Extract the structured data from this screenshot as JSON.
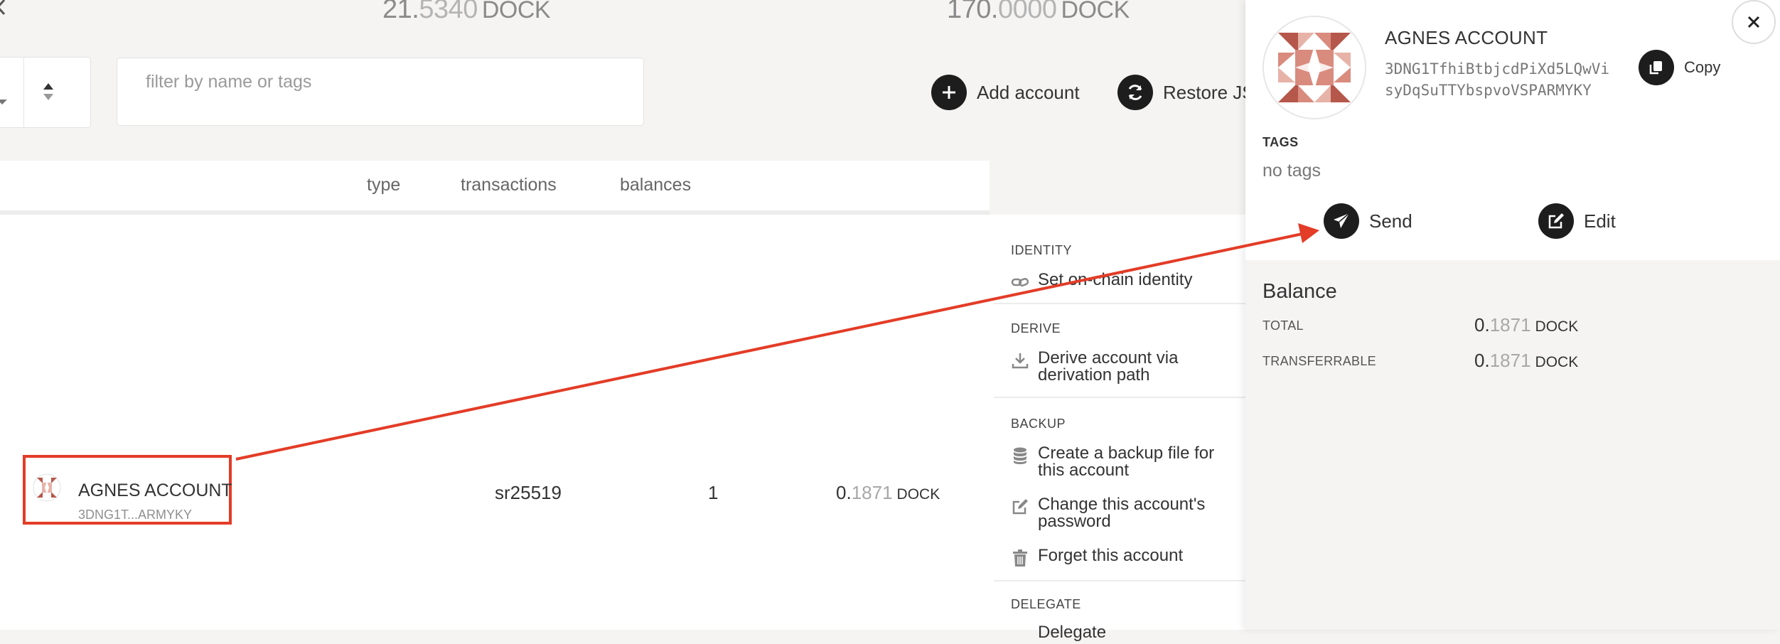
{
  "summary": {
    "left": {
      "int": "21.",
      "dec": "5340",
      "unit": "DOCK"
    },
    "right": {
      "int": "170.",
      "dec": "0000",
      "unit": "DOCK"
    }
  },
  "controls": {
    "filter_placeholder": "filter by name or tags",
    "add_account": "Add account",
    "restore_json": "Restore JSON"
  },
  "table": {
    "headers": {
      "type": "type",
      "transactions": "transactions",
      "balances": "balances"
    },
    "row": {
      "name": "AGNES ACCOUNT",
      "address_short": "3DNG1T...ARMYKY",
      "type": "sr25519",
      "transactions": "1",
      "balance": {
        "int": "0.",
        "dec": "1871",
        "unit": "DOCK"
      }
    }
  },
  "menu": {
    "identity_head": "IDENTITY",
    "identity_item": "Set on-chain identity",
    "derive_head": "DERIVE",
    "derive_item": "Derive account via derivation path",
    "backup_head": "BACKUP",
    "backup_item": "Create a backup file for this account",
    "password_item": "Change this account's password",
    "forget_item": "Forget this account",
    "delegate_head": "DELEGATE",
    "delegate_item": "Delegate"
  },
  "sidebar": {
    "name": "AGNES ACCOUNT",
    "address": "3DNG1TfhiBtbjcdPiXd5LQwVisyDqSuTTYbspvoVSPARMYKY",
    "copy_label": "Copy",
    "tags_label": "TAGS",
    "tags_value": "no tags",
    "send_label": "Send",
    "edit_label": "Edit",
    "balance_title": "Balance",
    "total_label": "TOTAL",
    "total_value": {
      "int": "0.",
      "dec": "1871",
      "unit": "DOCK"
    },
    "transferrable_label": "TRANSFERRABLE",
    "transferrable_value": {
      "int": "0.",
      "dec": "1871",
      "unit": "DOCK"
    }
  },
  "colors": {
    "annotation": "#e33c27",
    "button_dark": "#1d1d1d",
    "identicon_primary": "#b5574a",
    "identicon_light": "#e7b3a8"
  }
}
